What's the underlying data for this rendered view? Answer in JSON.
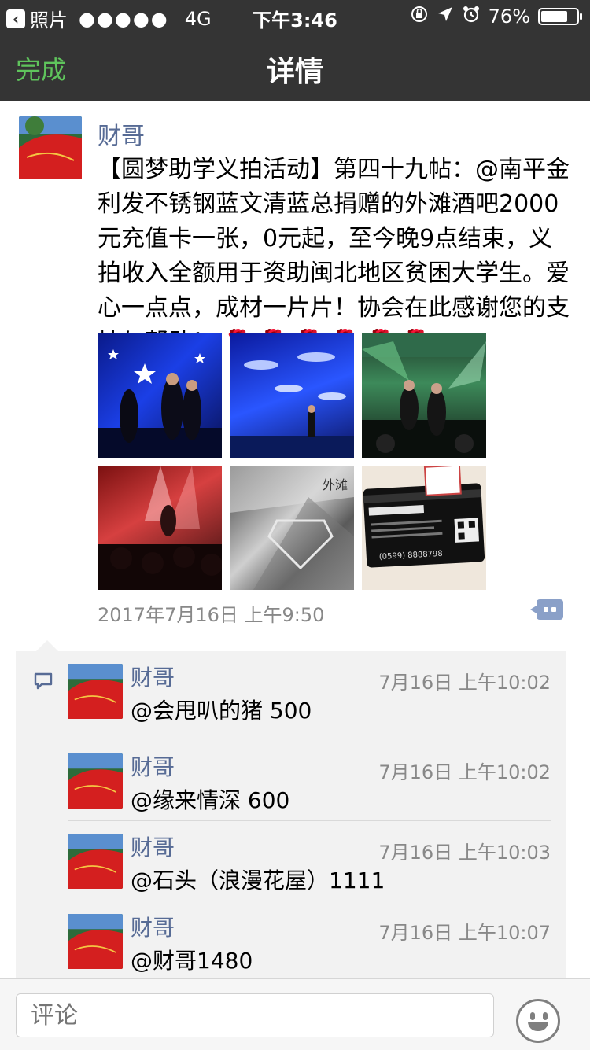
{
  "status_bar": {
    "carrier": "照片",
    "signal": "●●●●●",
    "network": "4G",
    "time": "下午3:46",
    "battery_percent": "76%",
    "battery_level": 0.76
  },
  "nav": {
    "done_label": "完成",
    "title": "详情"
  },
  "post": {
    "author": "财哥",
    "text": "【圆梦助学义拍活动】第四十九帖：@南平金利发不锈钢蓝文清蓝总捐赠的外滩酒吧2000元充值卡一张，0元起，至今晚9点结束，义拍收入全额用于资助闽北地区贫困大学生。爱心一点点，成材一片片！协会在此感谢您的支持与帮助！",
    "flowers": "🌹🌹🌹🌹🌹🌹",
    "date": "2017年7月16日 上午9:50",
    "card_number": "(0599) 8888798",
    "photos": [
      {
        "name": "concert-photo-1"
      },
      {
        "name": "concert-photo-2"
      },
      {
        "name": "concert-photo-3"
      },
      {
        "name": "concert-photo-4"
      },
      {
        "name": "vip-card-front"
      },
      {
        "name": "vip-card-back"
      }
    ]
  },
  "comments": [
    {
      "name": "财哥",
      "time": "7月16日 上午10:02",
      "text": "@会甩叭的猪 500"
    },
    {
      "name": "财哥",
      "time": "7月16日 上午10:02",
      "text": "@缘来情深 600"
    },
    {
      "name": "财哥",
      "time": "7月16日 上午10:03",
      "text": "@石头（浪漫花屋）1111"
    },
    {
      "name": "财哥",
      "time": "7月16日 上午10:07",
      "text": "@财哥1480"
    }
  ],
  "composer": {
    "placeholder": "评论"
  },
  "colors": {
    "accent_green": "#5fc45c",
    "link_blue": "#576b95",
    "topbar": "#343434"
  }
}
